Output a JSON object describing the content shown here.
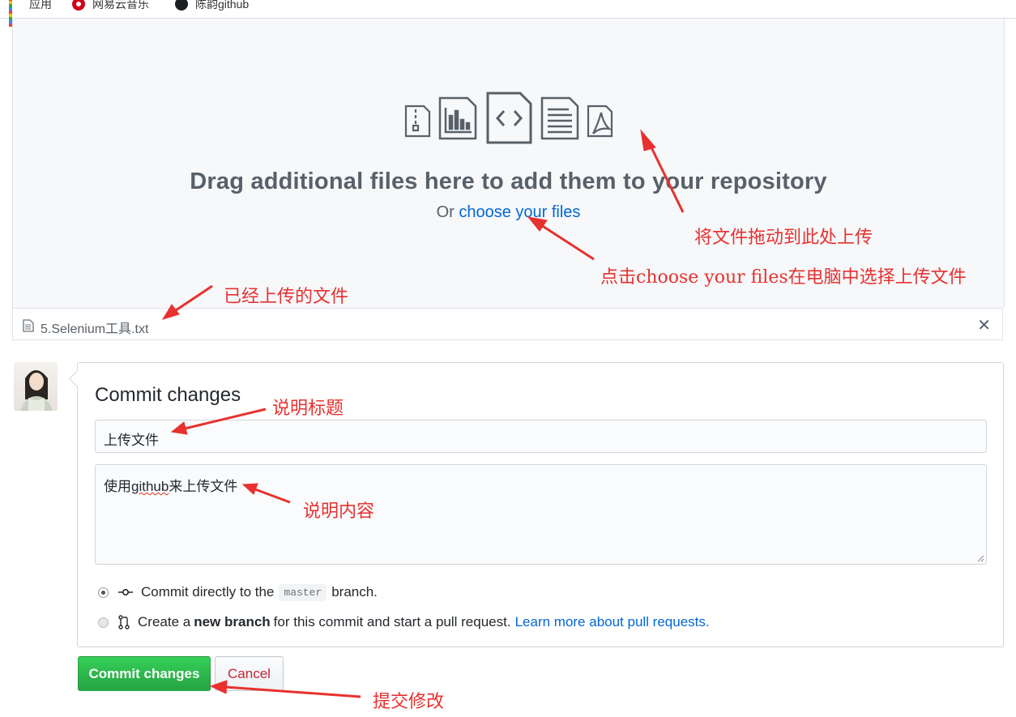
{
  "bookmarks": [
    {
      "label": "应用",
      "icon": "apps-grid-icon"
    },
    {
      "label": "网易云音乐",
      "icon": "netease-music-icon"
    },
    {
      "label": "陈韵github",
      "icon": "github-icon"
    }
  ],
  "dropzone": {
    "title": "Drag additional files here to add them to your repository",
    "prefix": "Or",
    "link": "choose your files",
    "icons": [
      "file-zip-icon",
      "graph-icon",
      "file-code-icon",
      "file-text-icon",
      "file-pdf-icon"
    ]
  },
  "uploaded_file": {
    "name": "5.Selenium工具.txt",
    "remove": "✕"
  },
  "commit": {
    "title": "Commit changes",
    "summary_value": "上传文件",
    "description_value_pre": "使用",
    "description_value_spell": "github",
    "description_value_post": "来上传文件",
    "option_direct_pre": "Commit directly to the",
    "option_direct_branch": "master",
    "option_direct_post": "branch.",
    "option_new_pre": "Create a",
    "option_new_bold": "new branch",
    "option_new_post": "for this commit and start a pull request.",
    "option_new_link": "Learn more about pull requests.",
    "selected_option": "direct"
  },
  "buttons": {
    "commit_label": "Commit changes",
    "cancel_label": "Cancel"
  },
  "annotations": {
    "drag_here": "将文件拖动到此处上传",
    "choose_files": "点击choose your files在电脑中选择上传文件",
    "uploaded": "已经上传的文件",
    "summary_note": "说明标题",
    "desc_note": "说明内容",
    "submit_note": "提交修改"
  },
  "colors": {
    "link": "#0366d6",
    "commit_green": "#28a745",
    "cancel_red": "#cb2431",
    "annotation_red": "#e8312f"
  }
}
